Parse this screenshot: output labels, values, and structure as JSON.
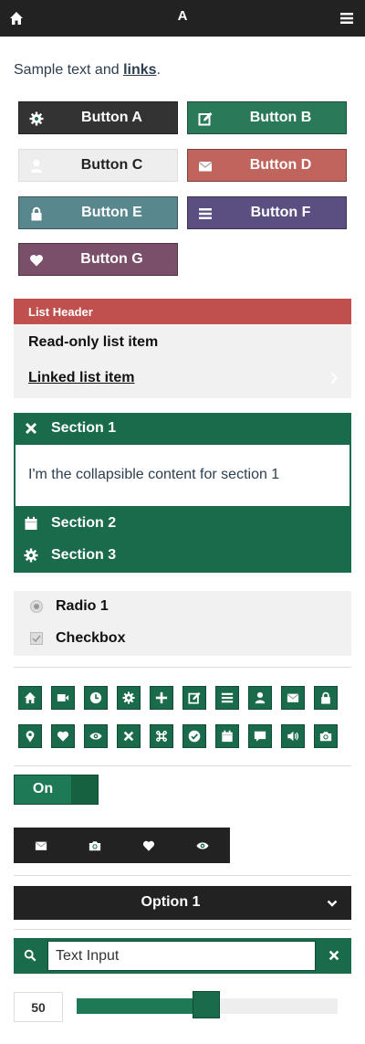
{
  "header": {
    "title": "A"
  },
  "intro": {
    "text": "Sample text and ",
    "link": "links",
    "end": "."
  },
  "buttons": [
    {
      "label": "Button A",
      "icon": "gear-icon",
      "color": "#333333"
    },
    {
      "label": "Button B",
      "icon": "edit-icon",
      "color": "#2a7a5a"
    },
    {
      "label": "Button C",
      "icon": "user-icon",
      "color": "#eeeeee"
    },
    {
      "label": "Button D",
      "icon": "mail-icon",
      "color": "#c0645d"
    },
    {
      "label": "Button E",
      "icon": "lock-icon",
      "color": "#58878e"
    },
    {
      "label": "Button F",
      "icon": "bars-icon",
      "color": "#5a4f80"
    },
    {
      "label": "Button G",
      "icon": "heart-icon",
      "color": "#7a4f69"
    }
  ],
  "list": {
    "header": "List Header",
    "items": [
      {
        "label": "Read-only list item"
      },
      {
        "label": "Linked list item"
      }
    ]
  },
  "collapsible": {
    "sections": [
      {
        "label": "Section 1",
        "icon": "close-icon"
      },
      {
        "label": "Section 2",
        "icon": "calendar-icon"
      },
      {
        "label": "Section 3",
        "icon": "gear-icon"
      }
    ],
    "content": "I'm the collapsible content for section 1"
  },
  "form": {
    "radio_label": "Radio 1",
    "checkbox_label": "Checkbox"
  },
  "icons": [
    "home-icon",
    "video-icon",
    "clock-icon",
    "gear-icon",
    "plus-icon",
    "edit-icon",
    "bars-icon",
    "user-icon",
    "mail-icon",
    "lock-icon",
    "location-icon",
    "heart-icon",
    "eye-icon",
    "close-icon",
    "command-icon",
    "check-icon",
    "calendar-icon",
    "comment-icon",
    "audio-icon",
    "camera-icon"
  ],
  "toggle": {
    "label": "On",
    "state": true
  },
  "navbar": {
    "icons": [
      "mail-icon",
      "camera-icon",
      "heart-icon",
      "eye-icon"
    ]
  },
  "select": {
    "value": "Option 1"
  },
  "search": {
    "value": "Text Input"
  },
  "slider": {
    "value": "50",
    "fraction": 0.5
  }
}
